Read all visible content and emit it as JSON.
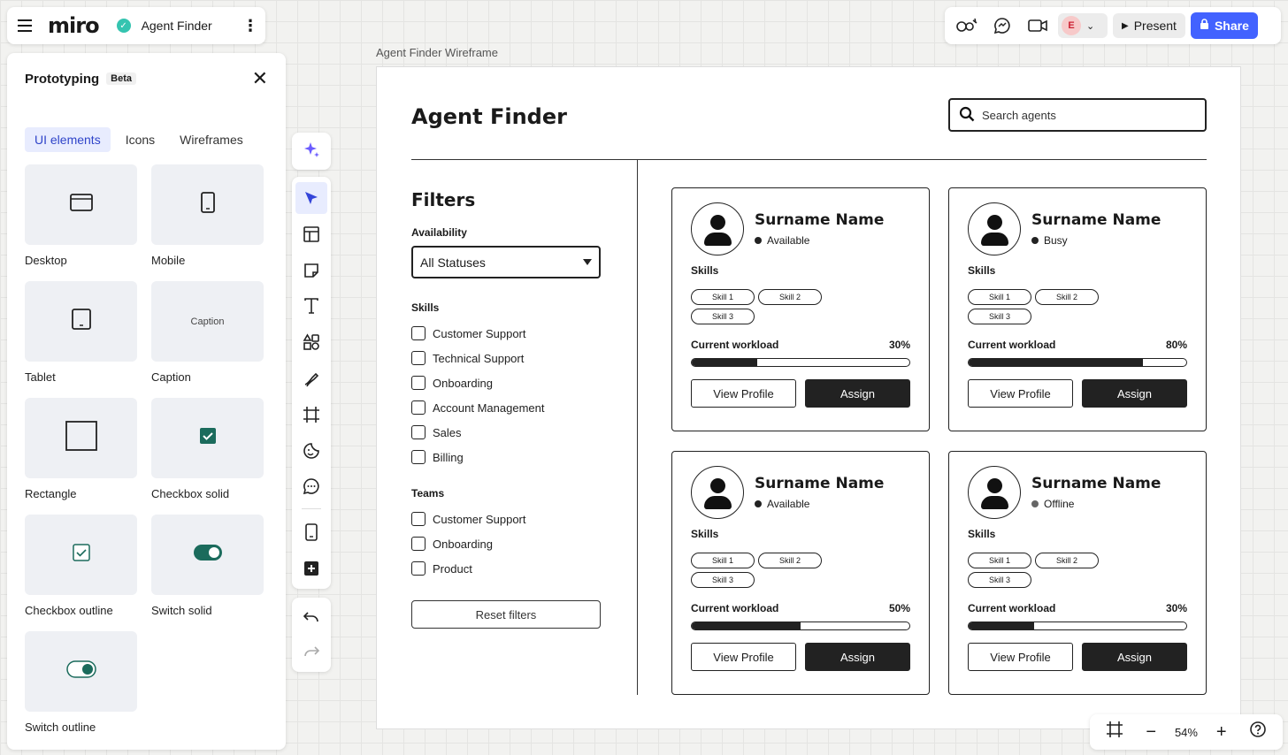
{
  "app": {
    "logo": "miro",
    "board_name": "Agent Finder"
  },
  "topbar": {
    "present_label": "Present",
    "share_label": "Share",
    "avatar_initial": "E"
  },
  "left_panel": {
    "title": "Prototyping",
    "badge": "Beta",
    "tabs": [
      {
        "label": "UI elements",
        "active": true
      },
      {
        "label": "Icons"
      },
      {
        "label": "Wireframes"
      }
    ],
    "elements": [
      {
        "label": "Desktop"
      },
      {
        "label": "Mobile"
      },
      {
        "label": "Tablet"
      },
      {
        "label": "Caption",
        "preview_text": "Caption"
      },
      {
        "label": "Rectangle"
      },
      {
        "label": "Checkbox solid"
      },
      {
        "label": "Checkbox outline"
      },
      {
        "label": "Switch solid"
      },
      {
        "label": "Switch outline"
      }
    ],
    "accent": "#1b6b5c"
  },
  "canvas": {
    "frame_label": "Agent Finder Wireframe",
    "title": "Agent Finder",
    "search_placeholder": "Search agents",
    "filters": {
      "title": "Filters",
      "availability_label": "Availability",
      "availability_value": "All Statuses",
      "skills_label": "Skills",
      "skills": [
        "Customer Support",
        "Technical Support",
        "Onboarding",
        "Account Management",
        "Sales",
        "Billing"
      ],
      "teams_label": "Teams",
      "teams": [
        "Customer Support",
        "Onboarding",
        "Product"
      ],
      "reset_label": "Reset filters"
    },
    "cards": [
      {
        "name": "Surname Name",
        "status": "Available",
        "skills_label": "Skills",
        "skills": [
          "Skill 1",
          "Skill 2",
          "Skill 3"
        ],
        "workload_label": "Current workload",
        "workload": "30%",
        "workload_value": 30,
        "view_label": "View Profile",
        "assign_label": "Assign"
      },
      {
        "name": "Surname Name",
        "status": "Busy",
        "skills_label": "Skills",
        "skills": [
          "Skill 1",
          "Skill 2",
          "Skill 3"
        ],
        "workload_label": "Current workload",
        "workload": "80%",
        "workload_value": 80,
        "view_label": "View Profile",
        "assign_label": "Assign"
      },
      {
        "name": "Surname Name",
        "status": "Available",
        "skills_label": "Skills",
        "skills": [
          "Skill 1",
          "Skill 2",
          "Skill 3"
        ],
        "workload_label": "Current workload",
        "workload": "50%",
        "workload_value": 50,
        "view_label": "View Profile",
        "assign_label": "Assign"
      },
      {
        "name": "Surname Name",
        "status": "Offline",
        "skills_label": "Skills",
        "skills": [
          "Skill 1",
          "Skill 2",
          "Skill 3"
        ],
        "workload_label": "Current workload",
        "workload": "30%",
        "workload_value": 30,
        "view_label": "View Profile",
        "assign_label": "Assign"
      }
    ]
  },
  "zoom": {
    "value": "54%"
  },
  "colors": {
    "brand_blue": "#4262ff",
    "accent_teal": "#35c4b0",
    "active_tool": "#e8ecfe"
  }
}
